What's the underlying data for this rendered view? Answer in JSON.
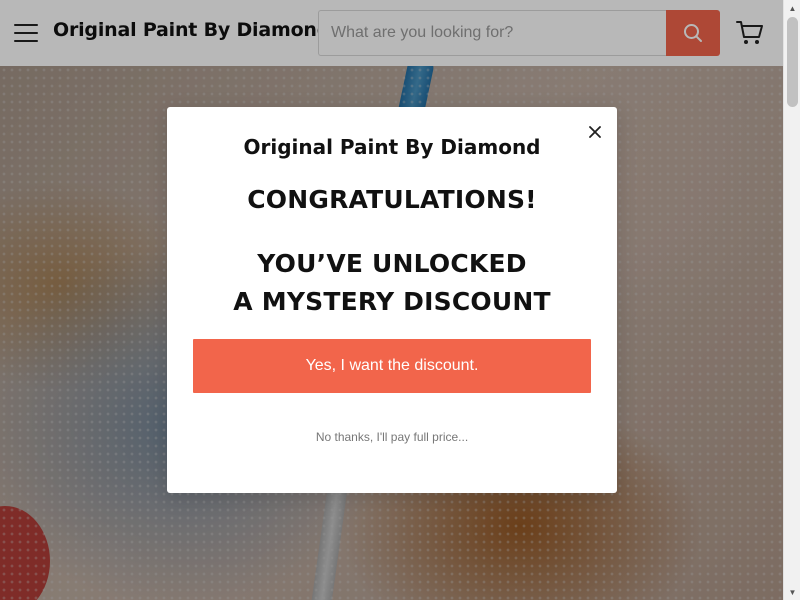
{
  "header": {
    "logo_text": "Original Paint By Diamond",
    "search_placeholder": "What are you looking for?",
    "search_value": ""
  },
  "modal": {
    "brand": "Original Paint By Diamond",
    "headline": "CONGRATULATIONS!",
    "subheadline_line1": "YOU’VE UNLOCKED",
    "subheadline_line2": "A MYSTERY DISCOUNT",
    "accept_label": "Yes, I want the discount.",
    "decline_label": "No thanks, I'll pay full price..."
  },
  "colors": {
    "accent": "#f2654b",
    "text": "#111111",
    "muted": "#777777",
    "overlay": "rgba(0,0,0,0.28)"
  },
  "icons": {
    "menu": "hamburger-icon",
    "search": "search-icon",
    "cart": "cart-icon",
    "close": "close-icon"
  }
}
